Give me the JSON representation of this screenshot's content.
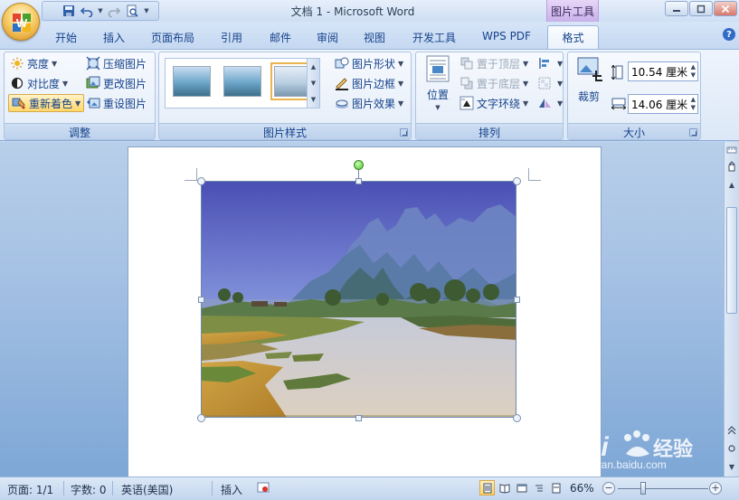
{
  "app": {
    "title": "文档 1 - Microsoft Word",
    "context_tool": "图片工具"
  },
  "colors": {
    "ribbon_bg": "#dce8f7",
    "text": "#15428b",
    "highlight": "#ffd86b",
    "context_tab": "#c8b1ea",
    "doc_bg": "#a5c1e4"
  },
  "tabs": [
    {
      "label": "开始"
    },
    {
      "label": "插入"
    },
    {
      "label": "页面布局"
    },
    {
      "label": "引用"
    },
    {
      "label": "邮件"
    },
    {
      "label": "审阅"
    },
    {
      "label": "视图"
    },
    {
      "label": "开发工具"
    },
    {
      "label": "WPS PDF"
    },
    {
      "label": "格式",
      "active": true
    }
  ],
  "ribbon": {
    "adjust": {
      "label": "调整",
      "brightness": "亮度",
      "contrast": "对比度",
      "recolor": "重新着色",
      "compress": "压缩图片",
      "change": "更改图片",
      "reset": "重设图片"
    },
    "styles": {
      "label": "图片样式",
      "shape": "图片形状",
      "border": "图片边框",
      "effects": "图片效果"
    },
    "arrange": {
      "label": "排列",
      "position": "位置",
      "bring_front": "置于顶层",
      "send_back": "置于底层",
      "wrap": "文字环绕"
    },
    "size": {
      "label": "大小",
      "crop": "裁剪",
      "height": "10.54 厘米",
      "width": "14.06 厘米"
    }
  },
  "statusbar": {
    "page": "页面: 1/1",
    "words": "字数: 0",
    "language": "英语(美国)",
    "mode": "插入",
    "zoom": "66%",
    "zoom_minus": "−",
    "zoom_plus": "+"
  },
  "watermark": {
    "brand": "Bai 经验",
    "url": "jingyan.baidu.com"
  }
}
